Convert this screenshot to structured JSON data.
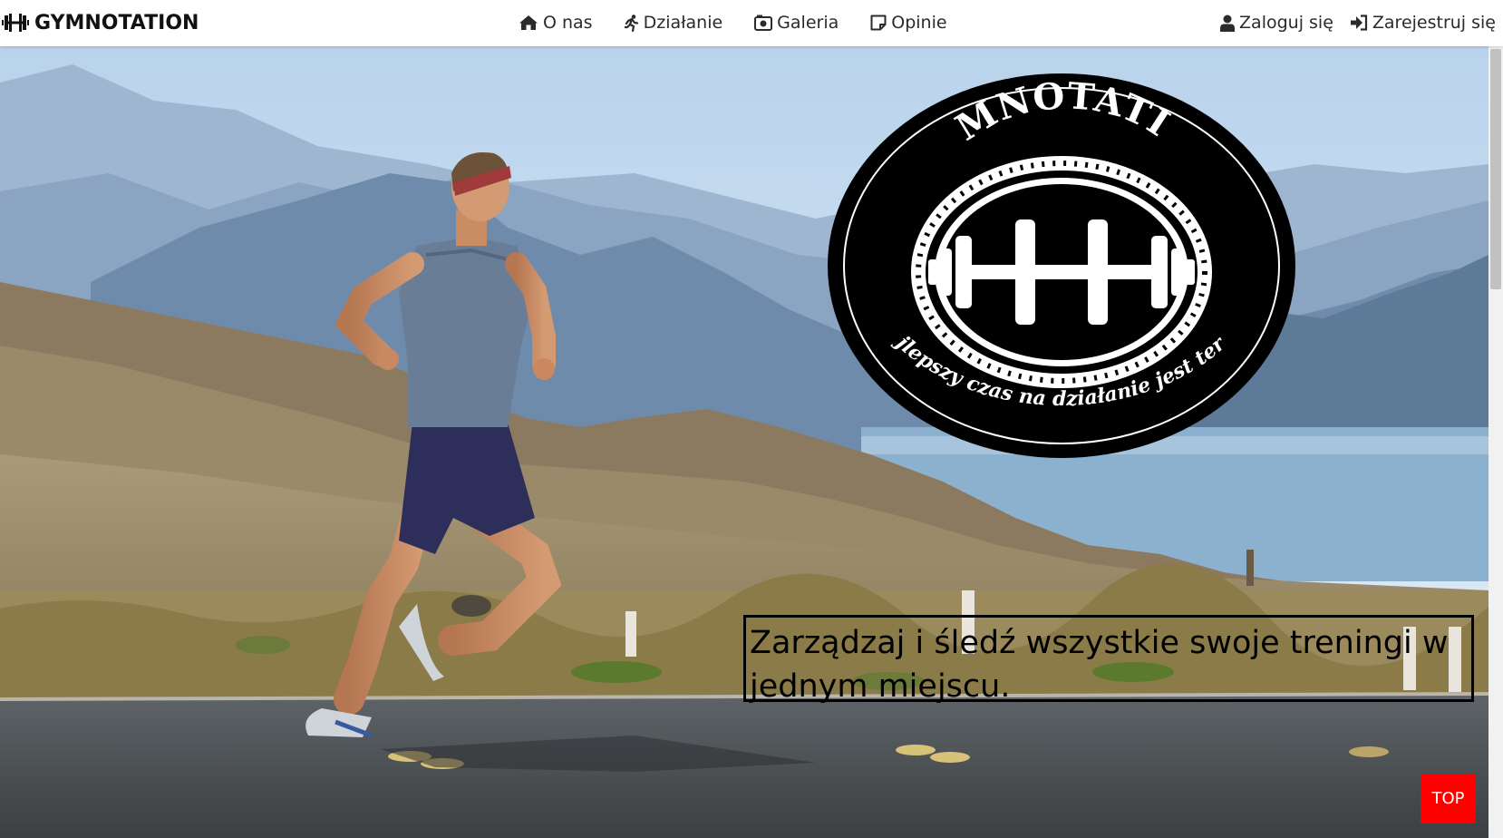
{
  "brand": {
    "name": "GYMNOTATION",
    "icon": "dumbbell-icon"
  },
  "nav": {
    "links": [
      {
        "label": "O nas",
        "icon": "home-icon"
      },
      {
        "label": "Działanie",
        "icon": "running-icon"
      },
      {
        "label": "Galeria",
        "icon": "camera-icon"
      },
      {
        "label": "Opinie",
        "icon": "note-icon"
      }
    ],
    "auth": [
      {
        "label": "Zaloguj się",
        "icon": "user-icon"
      },
      {
        "label": "Zarejestruj się",
        "icon": "sign-in-icon"
      }
    ]
  },
  "hero": {
    "logo_title": "GYMNOTATION",
    "logo_motto": "Najlepszy czas na działanie jest teraz!",
    "tagline": "Zarządzaj i śledź wszystkie swoje treningi w jednym miejscu."
  },
  "top_button": {
    "label": "TOP"
  },
  "colors": {
    "accent": "#ff0000",
    "text": "#2b2b2b"
  }
}
